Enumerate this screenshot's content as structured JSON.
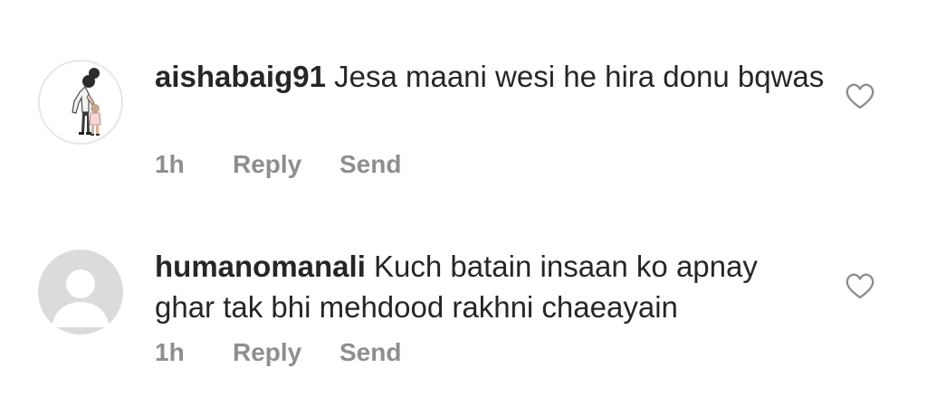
{
  "comments": [
    {
      "username": "aishabaig91",
      "text": "Jesa maani wesi he hira donu bqwas",
      "time": "1h",
      "reply_label": "Reply",
      "send_label": "Send",
      "avatar": "illustrated-avatar",
      "like_icon": "heart-outline-icon"
    },
    {
      "username": "humanomanali",
      "text": "Kuch batain insaan ko apnay ghar tak bhi mehdood rakhni chaeayain",
      "time": "1h",
      "reply_label": "Reply",
      "send_label": "Send",
      "avatar": "default-avatar",
      "like_icon": "heart-outline-icon"
    }
  ],
  "colors": {
    "text": "#262626",
    "secondary": "#8e8e8e",
    "avatar_placeholder": "#dbdbdb"
  }
}
